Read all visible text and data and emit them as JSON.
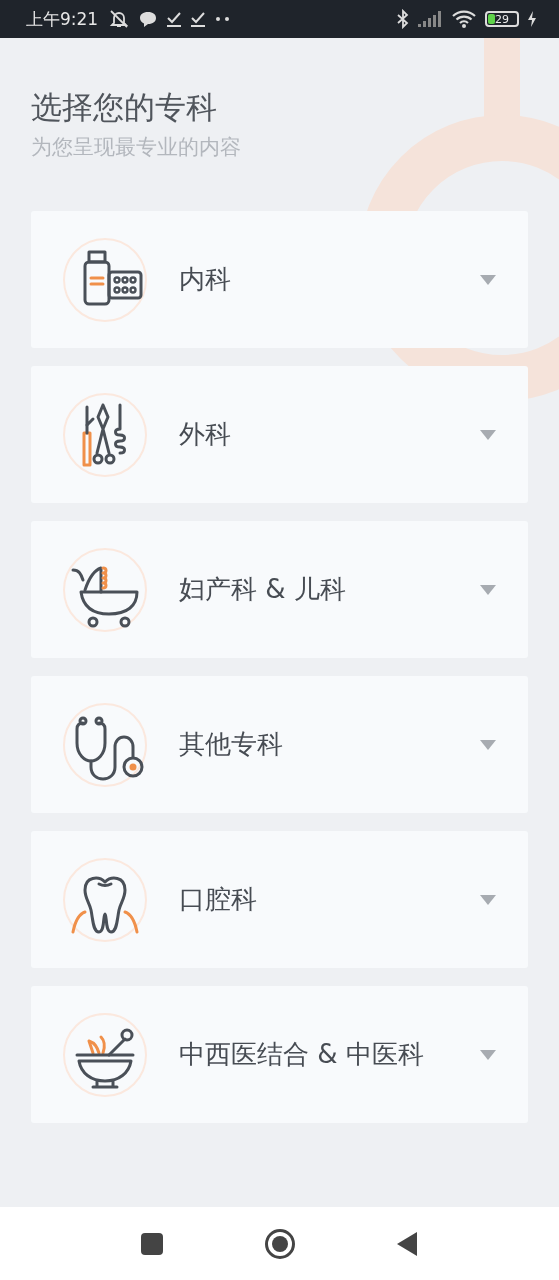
{
  "status_bar": {
    "time": "上午9:21",
    "battery": "29"
  },
  "header": {
    "title": "选择您的专科",
    "subtitle": "为您呈现最专业的内容"
  },
  "specialties": [
    {
      "label": "内科",
      "kind": "medicine",
      "expanded": false
    },
    {
      "label": "外科",
      "kind": "surgery",
      "expanded": false
    },
    {
      "label": "妇产科 & 儿科",
      "kind": "stroller",
      "expanded": false
    },
    {
      "label": "其他专科",
      "kind": "stethoscope",
      "expanded": false
    },
    {
      "label": "口腔科",
      "kind": "tooth",
      "expanded": false
    },
    {
      "label": "中西医结合 & 中医科",
      "kind": "mortar",
      "expanded": false
    }
  ]
}
